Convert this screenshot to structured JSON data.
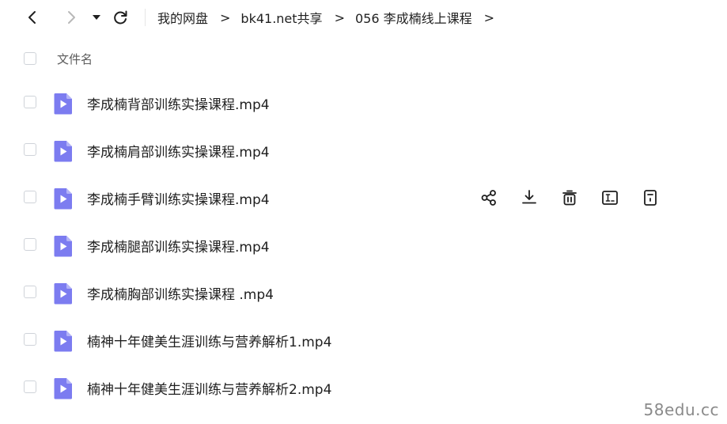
{
  "toolbar": {
    "back_icon": "chevron-left-icon",
    "forward_icon": "chevron-right-icon",
    "dropdown_icon": "caret-down-icon",
    "refresh_icon": "refresh-icon"
  },
  "breadcrumb": {
    "items": [
      "我的网盘",
      "bk41.net共享",
      "056 李成楠线上课程"
    ],
    "separator": ">"
  },
  "list_header": {
    "name_label": "文件名"
  },
  "files": [
    {
      "name": "李成楠背部训练实操课程.mp4"
    },
    {
      "name": "李成楠肩部训练实操课程.mp4"
    },
    {
      "name": "李成楠手臂训练实操课程.mp4"
    },
    {
      "name": "李成楠腿部训练实操课程.mp4"
    },
    {
      "name": "李成楠胸部训练实操课程 .mp4"
    },
    {
      "name": "楠神十年健美生涯训练与营养解析1.mp4"
    },
    {
      "name": "楠神十年健美生涯训练与营养解析2.mp4"
    }
  ],
  "hovered_row_actions": [
    "share-icon",
    "download-icon",
    "delete-icon",
    "rename-icon",
    "details-icon"
  ],
  "colors": {
    "video_icon": "#7c7cf0",
    "text": "#1f1f1f",
    "muted": "#5c5c5c",
    "checkbox_border": "#cfd3d9"
  },
  "watermark": "58edu.cc"
}
